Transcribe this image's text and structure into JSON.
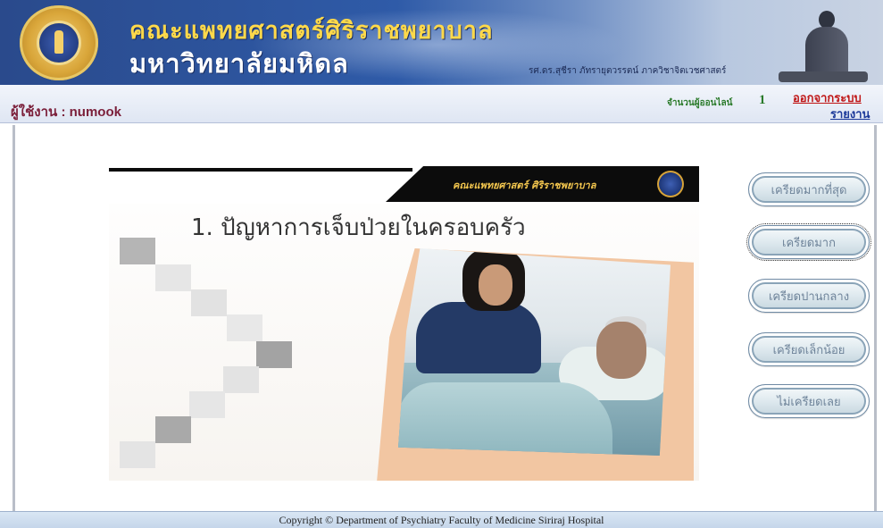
{
  "header": {
    "title_line1": "คณะแพทยศาสตร์ศิริราชพยาบาล",
    "title_line2": "มหาวิทยาลัยมหิดล",
    "dean_caption": "รศ.ดร.สุชีรา ภัทรายุตวรรตน์ ภาควิชาจิตเวชศาสตร์"
  },
  "userbar": {
    "user_label": "ผู้ใช้งาน : numook",
    "online_label": "จำนวนผู้ออนไลน์",
    "online_count": "1",
    "logout": "ออกจากระบบ",
    "report": "รายงาน"
  },
  "slide": {
    "header_text": "คณะแพทยศาสตร์ ศิริราชพยาบาล",
    "title": "1. ปัญหาการเจ็บป่วยในครอบครัว"
  },
  "options": [
    {
      "label": "เครียดมากที่สุด"
    },
    {
      "label": "เครียดมาก"
    },
    {
      "label": "เครียดปานกลาง"
    },
    {
      "label": "เครียดเล็กน้อย"
    },
    {
      "label": "ไม่เครียดเลย"
    }
  ],
  "footer": {
    "copyright": "Copyright © Department of  Psychiatry Faculty of  Medicine Siriraj  Hospital"
  }
}
